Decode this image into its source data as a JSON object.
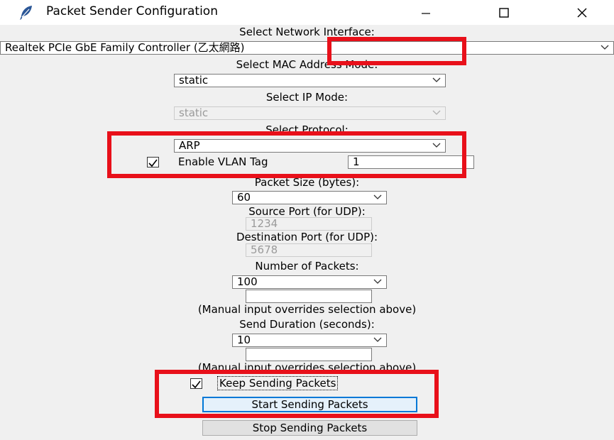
{
  "window": {
    "title": "Packet Sender Configuration",
    "icon": "feather-icon"
  },
  "network_interface": {
    "label": "Select Network Interface:",
    "value": "Realtek PCIe GbE Family Controller (乙太網路)"
  },
  "mac_mode": {
    "label": "Select MAC Address Mode:",
    "value": "static"
  },
  "ip_mode": {
    "label": "Select IP Mode:",
    "value": "static"
  },
  "protocol": {
    "label": "Select Protocol:",
    "value": "ARP"
  },
  "vlan": {
    "label": "Enable VLAN Tag",
    "checked": true,
    "value": "1"
  },
  "packet_size": {
    "label": "Packet Size (bytes):",
    "value": "60"
  },
  "source_port": {
    "label": "Source Port (for UDP):",
    "value": "1234"
  },
  "destination_port": {
    "label": "Destination Port (for UDP):",
    "value": "5678"
  },
  "num_packets": {
    "label": "Number of Packets:",
    "value": "100",
    "manual": "",
    "note": "(Manual input overrides selection above)"
  },
  "duration": {
    "label": "Send Duration (seconds):",
    "value": "10",
    "manual": "",
    "note": "(Manual input overrides selection above)"
  },
  "keep_sending": {
    "label": "Keep Sending Packets",
    "checked": true
  },
  "buttons": {
    "start": "Start Sending Packets",
    "stop": "Stop Sending Packets"
  },
  "colors": {
    "highlight": "#e8101a",
    "focus": "#0078d7",
    "window_bg": "#f0f0f0"
  }
}
